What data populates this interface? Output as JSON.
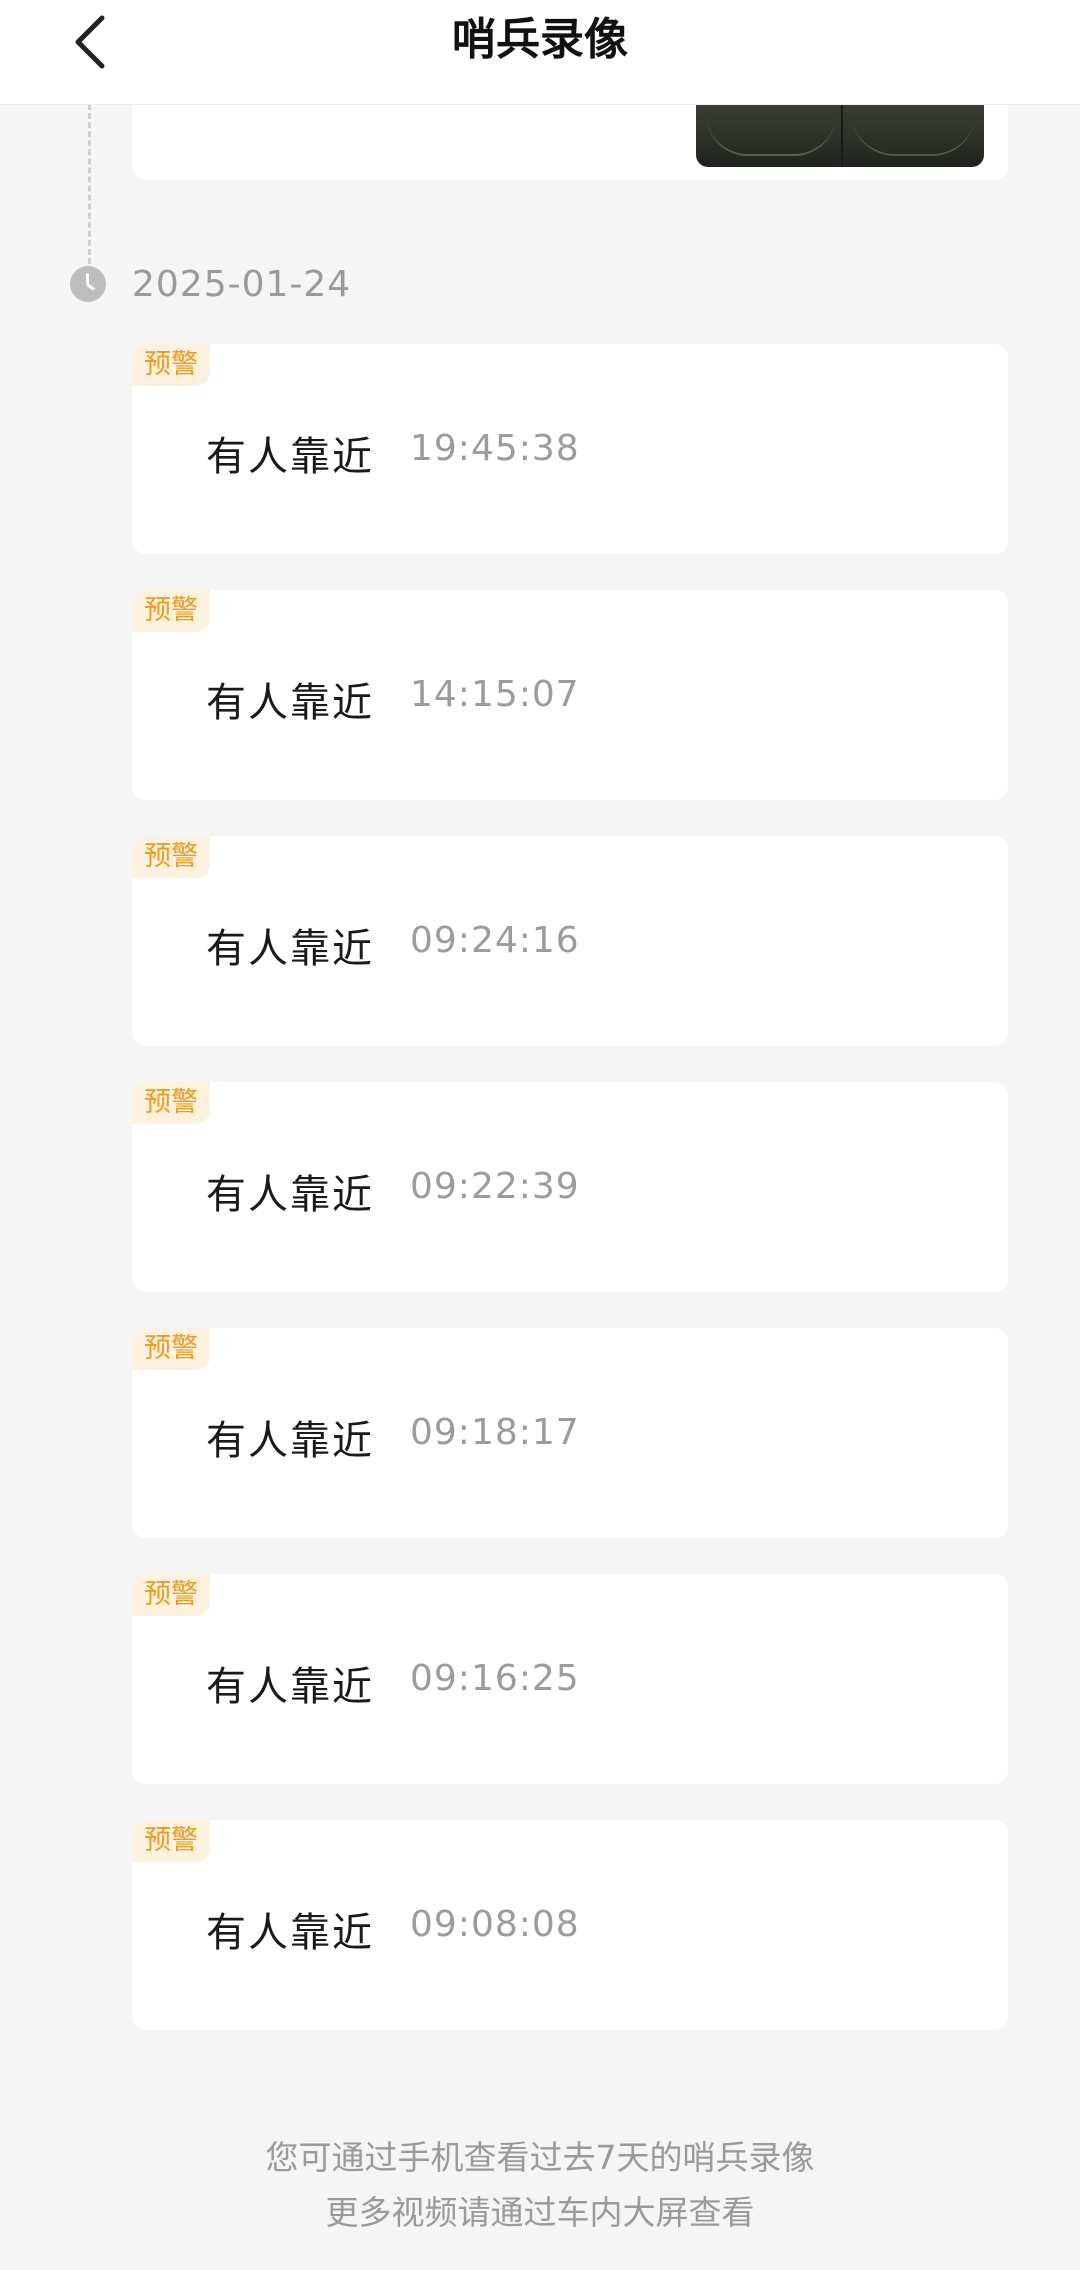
{
  "header": {
    "title": "哨兵录像",
    "back_icon": "chevron-left-icon"
  },
  "timeline": {
    "date": "2025-01-24",
    "date_icon": "clock-icon",
    "events": [
      {
        "badge": "预警",
        "title": "有人靠近",
        "time": "19:45:38"
      },
      {
        "badge": "预警",
        "title": "有人靠近",
        "time": "14:15:07"
      },
      {
        "badge": "预警",
        "title": "有人靠近",
        "time": "09:24:16"
      },
      {
        "badge": "预警",
        "title": "有人靠近",
        "time": "09:22:39"
      },
      {
        "badge": "预警",
        "title": "有人靠近",
        "time": "09:18:17"
      },
      {
        "badge": "预警",
        "title": "有人靠近",
        "time": "09:16:25"
      },
      {
        "badge": "预警",
        "title": "有人靠近",
        "time": "09:08:08"
      }
    ]
  },
  "footer": {
    "line1": "您可通过手机查看过去7天的哨兵录像",
    "line2": "更多视频请通过车内大屏查看"
  },
  "colors": {
    "badge_text": "#f09a1e",
    "badge_bg": "#fdf1e0",
    "page_bg": "#f5f5f5"
  }
}
